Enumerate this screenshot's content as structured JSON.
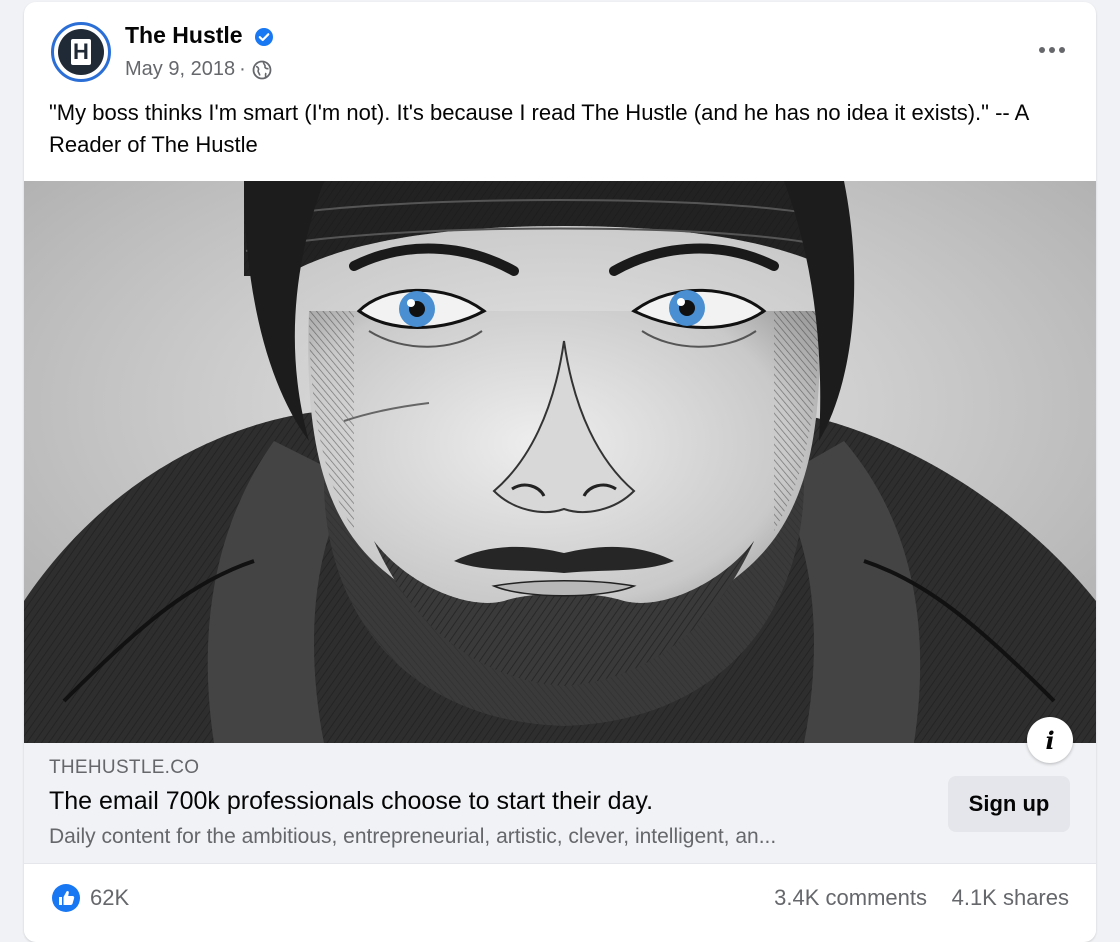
{
  "post": {
    "page_name": "The Hustle",
    "avatar_letter": "H",
    "date": "May 9, 2018",
    "separator": "·",
    "caption": "\"My boss thinks I'm smart (I'm not). It's because I read The Hustle (and he has no idea it exists).\" -- A Reader of The Hustle",
    "privacy_icon": "globe-icon",
    "menu_icon": "more-options-icon"
  },
  "link_preview": {
    "domain": "THEHUSTLE.CO",
    "headline": "The email 700k professionals choose to start their day.",
    "description": "Daily content for the ambitious, entrepreneurial, artistic, clever, intelligent, an...",
    "cta_label": "Sign up",
    "info_label": "i"
  },
  "engagement": {
    "likes": "62K",
    "comments": "3.4K comments",
    "shares": "4.1K shares"
  },
  "colors": {
    "brand_blue": "#1877f2",
    "secondary_text": "#65676b",
    "link_bg": "#f0f2f5",
    "button_bg": "#e4e6eb",
    "eye_blue": "#4a8fd1"
  }
}
